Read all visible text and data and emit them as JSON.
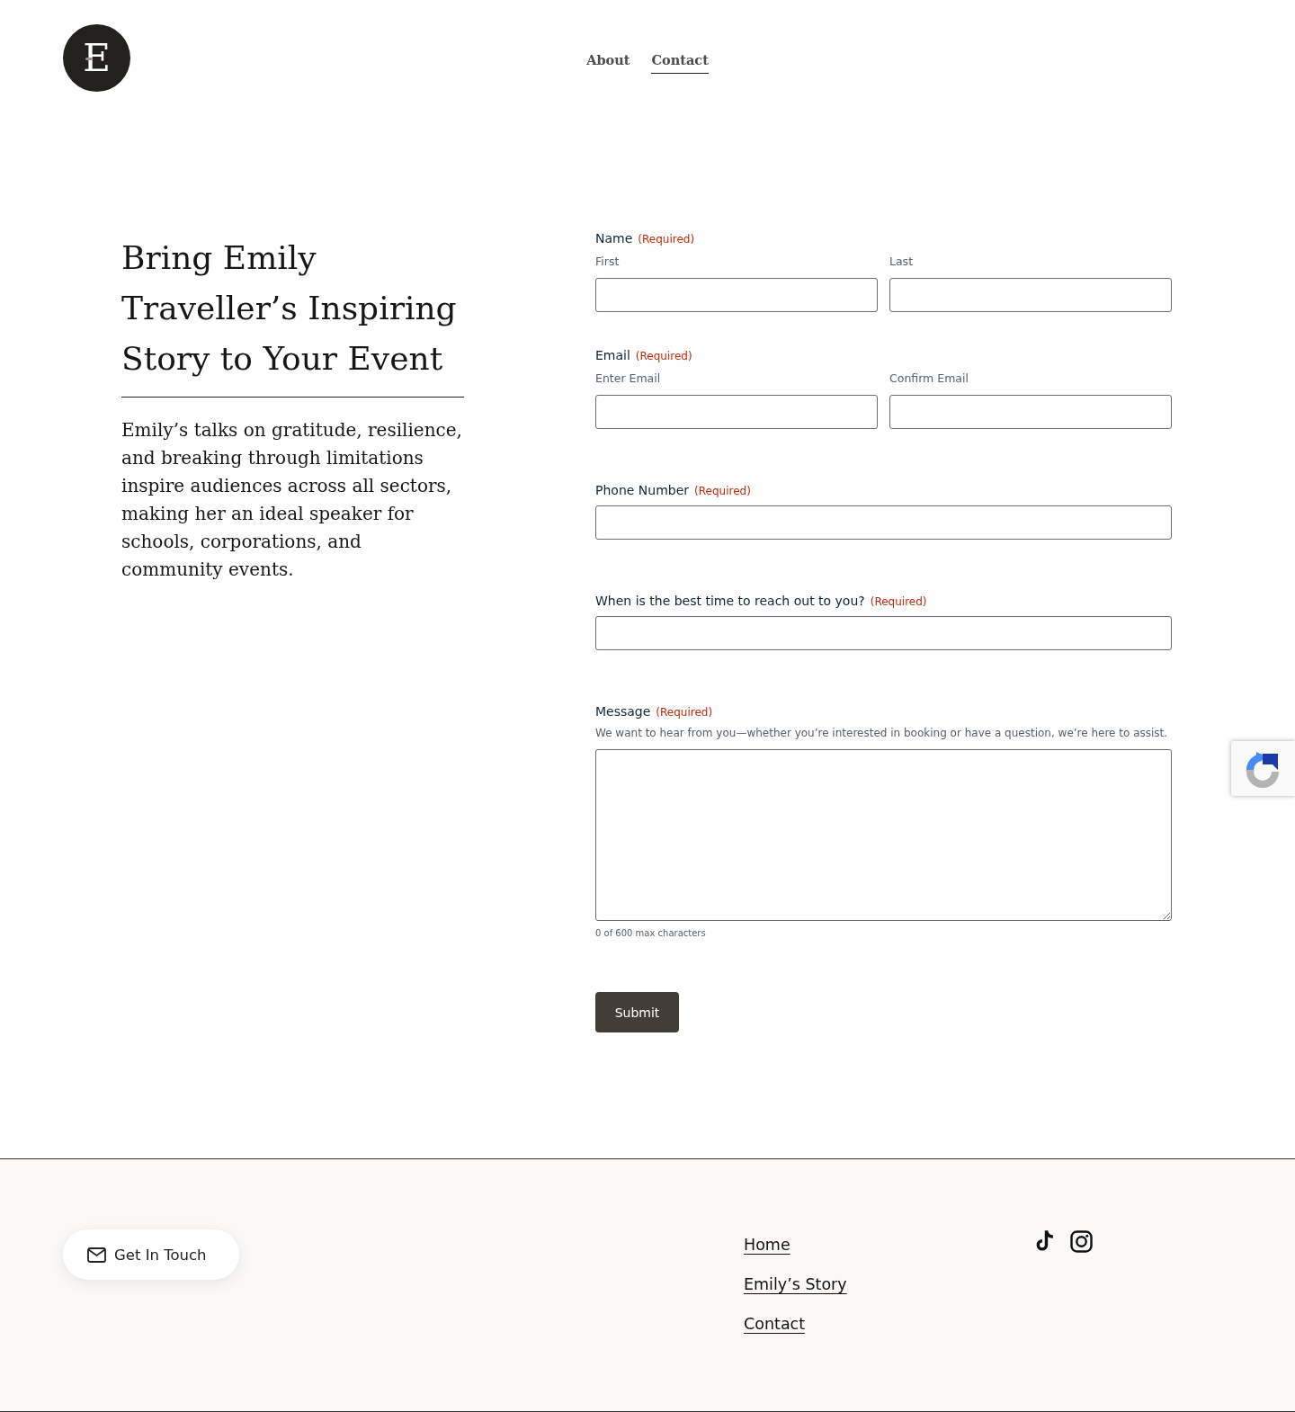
{
  "header": {
    "logo": "E",
    "nav": [
      {
        "label": "About",
        "selected": false
      },
      {
        "label": "Contact",
        "selected": true
      }
    ]
  },
  "intro": {
    "heading": "Bring Emily Traveller’s Inspiring Story to Your Event",
    "body": "Emily’s talks on gratitude, resilience, and breaking through limitations inspire audiences across all sectors, making her an ideal speaker for schools, corporations, and community events."
  },
  "form": {
    "fields": [
      {
        "kind": "split",
        "label": "Name",
        "required": "(Required)",
        "sublabels": [
          "First",
          "Last"
        ]
      },
      {
        "kind": "split",
        "label": "Email",
        "required": "(Required)",
        "sublabels": [
          "Enter Email",
          "Confirm Email"
        ]
      },
      {
        "kind": "single",
        "label": "Phone Number",
        "required": "(Required)"
      },
      {
        "kind": "single",
        "label": "When is the best time to reach out to you?",
        "required": "(Required)"
      },
      {
        "kind": "textarea",
        "label": "Message",
        "required": "(Required)",
        "description": "We want to hear from you—whether you’re interested in booking or have a question, we’re here to assist.",
        "counter": "0 of 600 max characters"
      }
    ],
    "submit": "Submit"
  },
  "footer": {
    "button": "Get In Touch",
    "links": [
      "Home",
      "Emily’s Story",
      "Contact"
    ]
  }
}
